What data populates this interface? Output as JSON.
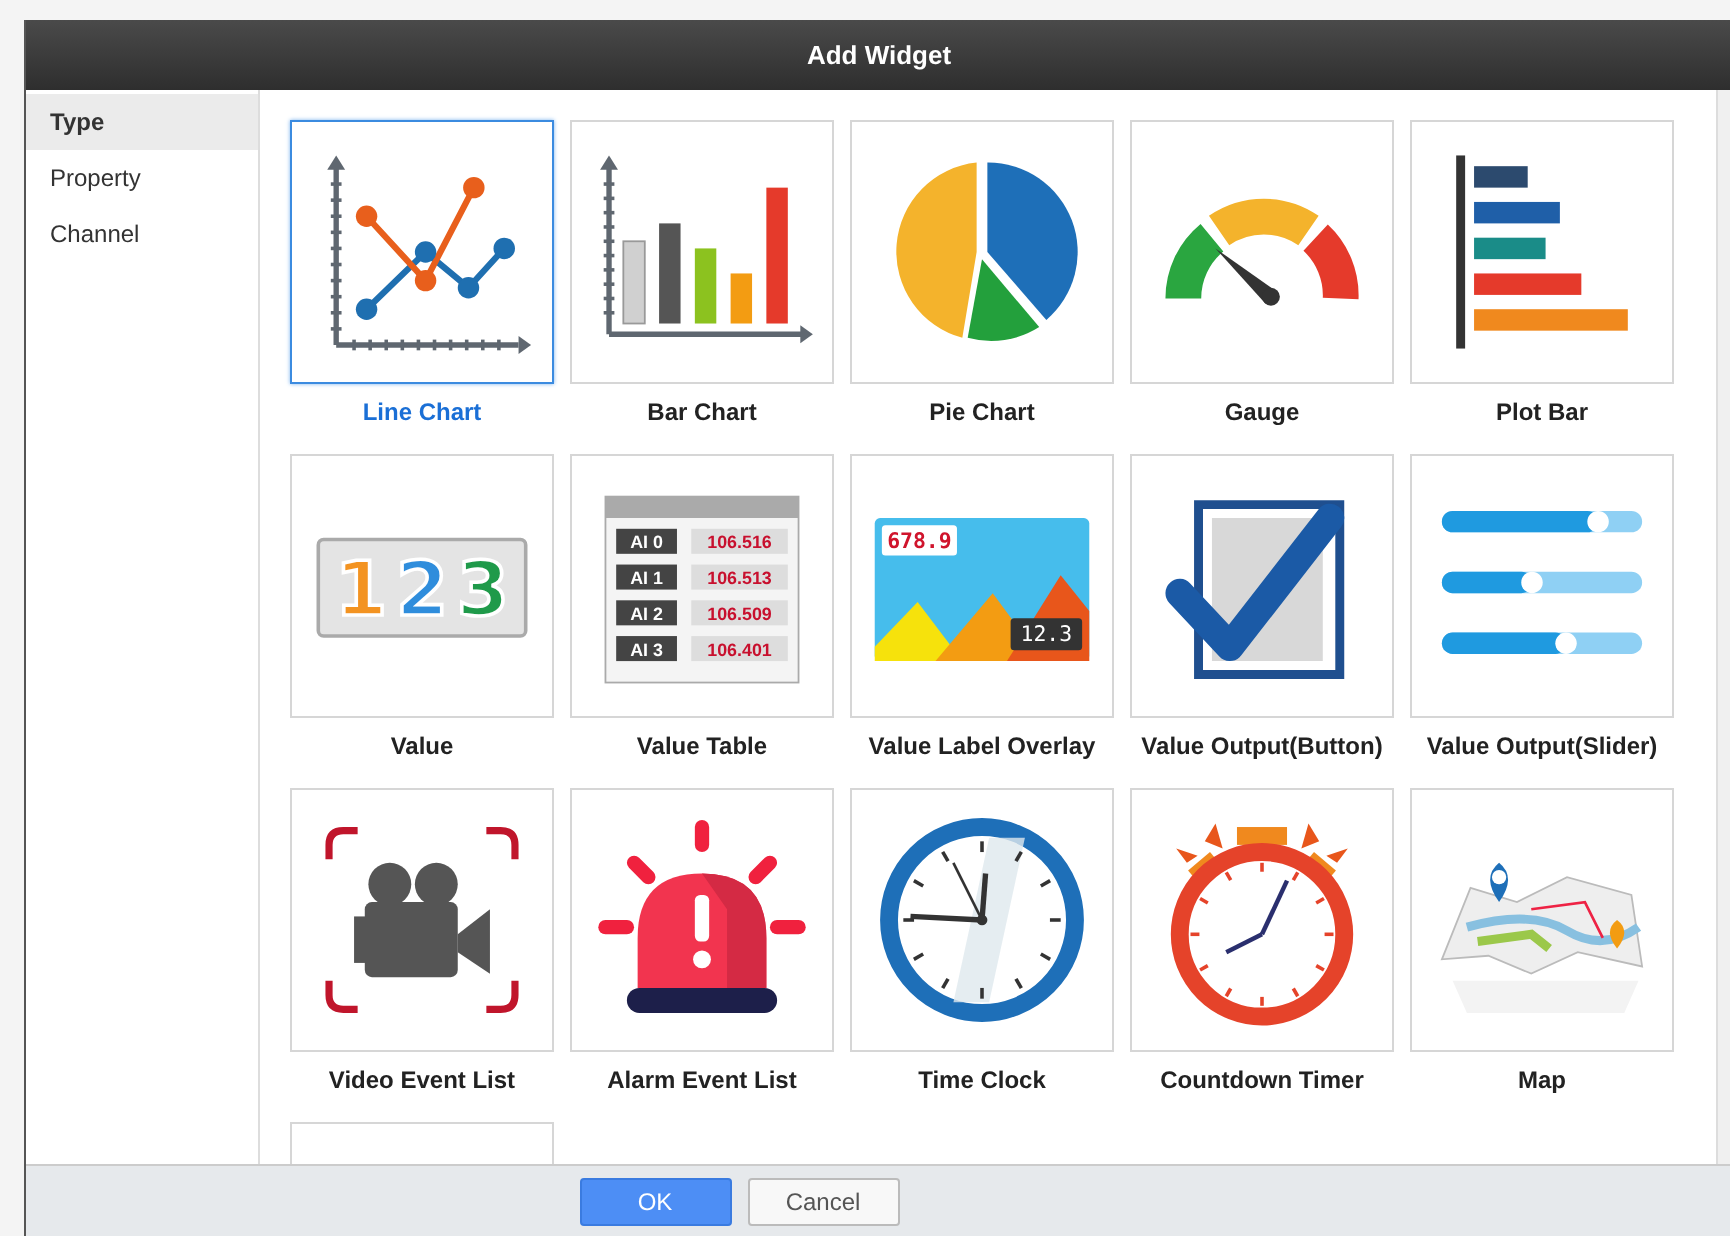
{
  "window": {
    "title": "Add Widget"
  },
  "sidebar": {
    "items": [
      {
        "label": "Type",
        "selected": true
      },
      {
        "label": "Property",
        "selected": false
      },
      {
        "label": "Channel",
        "selected": false
      }
    ]
  },
  "widgets": [
    {
      "kind": "line",
      "label": "Line Chart",
      "selected": true
    },
    {
      "kind": "bar",
      "label": "Bar Chart",
      "selected": false
    },
    {
      "kind": "pie",
      "label": "Pie Chart",
      "selected": false
    },
    {
      "kind": "gauge",
      "label": "Gauge",
      "selected": false
    },
    {
      "kind": "plotbar",
      "label": "Plot Bar",
      "selected": false
    },
    {
      "kind": "value",
      "label": "Value",
      "selected": false,
      "digits": [
        "1",
        "2",
        "3"
      ]
    },
    {
      "kind": "table",
      "label": "Value Table",
      "selected": false,
      "rows": [
        {
          "name": "AI 0",
          "value": "106.516"
        },
        {
          "name": "AI 1",
          "value": "106.513"
        },
        {
          "name": "AI 2",
          "value": "106.509"
        },
        {
          "name": "AI 3",
          "value": "106.401"
        }
      ]
    },
    {
      "kind": "overlay",
      "label": "Value Label Overlay",
      "selected": false,
      "values": [
        "678.9",
        "12.3"
      ]
    },
    {
      "kind": "button",
      "label": "Value Output(Button)",
      "selected": false
    },
    {
      "kind": "slider",
      "label": "Value Output(Slider)",
      "selected": false
    },
    {
      "kind": "video",
      "label": "Video Event List",
      "selected": false
    },
    {
      "kind": "alarm",
      "label": "Alarm Event List",
      "selected": false
    },
    {
      "kind": "clock",
      "label": "Time Clock",
      "selected": false
    },
    {
      "kind": "timer",
      "label": "Countdown Timer",
      "selected": false
    },
    {
      "kind": "map",
      "label": "Map",
      "selected": false
    },
    {
      "kind": "partial",
      "selected": false
    }
  ],
  "buttons": [
    {
      "label": "OK",
      "kind": "primary"
    },
    {
      "label": "Cancel",
      "kind": "secondary"
    }
  ]
}
